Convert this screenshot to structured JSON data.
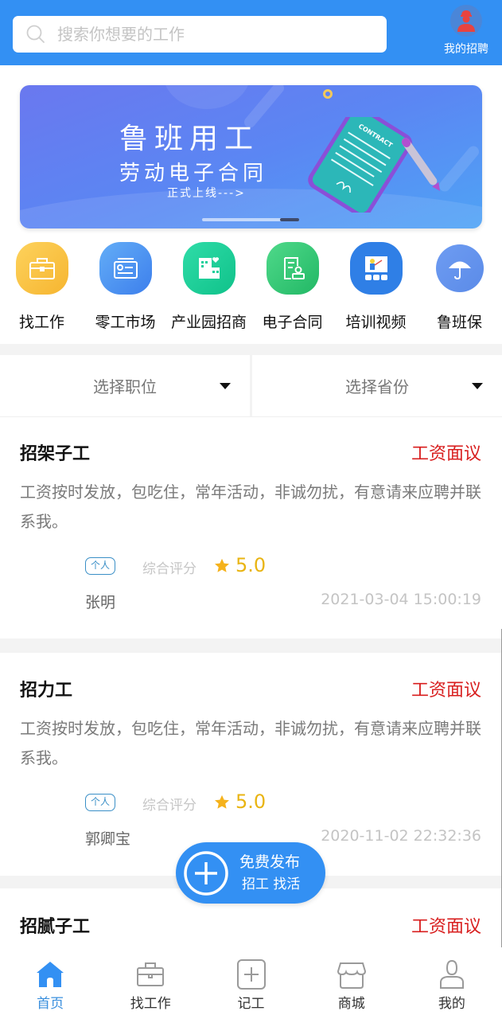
{
  "header": {
    "search_placeholder": "搜索你想要的工作",
    "my_recruit_label": "我的招聘"
  },
  "banner": {
    "title": "鲁班用工",
    "subtitle": "劳动电子合同",
    "cta": "正式上线--->",
    "contract_label": "CONTRACT",
    "slide_count": 2,
    "active_slide": 2
  },
  "quick_menu": [
    {
      "label": "找工作",
      "icon": "briefcase-icon",
      "color": "#f9c33f"
    },
    {
      "label": "零工市场",
      "icon": "id-card-icon",
      "color": "#4f93f0"
    },
    {
      "label": "产业园招商",
      "icon": "building-icon",
      "color": "#19cf9a"
    },
    {
      "label": "电子合同",
      "icon": "contract-stamp-icon",
      "color": "#2ec77a"
    },
    {
      "label": "培训视频",
      "icon": "training-icon",
      "color": "#2f7fe6"
    },
    {
      "label": "鲁班保",
      "icon": "umbrella-icon",
      "color": "#6e9cf2"
    }
  ],
  "filters": [
    {
      "label": "选择职位"
    },
    {
      "label": "选择省份"
    }
  ],
  "jobs": [
    {
      "title": "招架子工",
      "salary": "工资面议",
      "description": "工资按时发放，包吃住，常年活动，非诚勿扰，有意请来应聘并联系我。",
      "tag": "个人",
      "rating_label": "综合评分",
      "rating": "5.0",
      "poster": "张明",
      "time": "2021-03-04 15:00:19"
    },
    {
      "title": "招力工",
      "salary": "工资面议",
      "description": "工资按时发放，包吃住，常年活动，非诚勿扰，有意请来应聘并联系我。",
      "tag": "个人",
      "rating_label": "综合评分",
      "rating": "5.0",
      "poster": "郭卿宝",
      "time": "2020-11-02 22:32:36"
    },
    {
      "title": "招腻子工",
      "salary": "工资面议"
    }
  ],
  "fab": {
    "line1": "免费发布",
    "line2": "招工 找活"
  },
  "tabbar": [
    {
      "label": "首页",
      "icon": "home-icon",
      "active": true
    },
    {
      "label": "找工作",
      "icon": "briefcase-icon",
      "active": false
    },
    {
      "label": "记工",
      "icon": "plus-square-icon",
      "active": false
    },
    {
      "label": "商城",
      "icon": "shop-icon",
      "active": false
    },
    {
      "label": "我的",
      "icon": "user-icon",
      "active": false
    }
  ],
  "colors": {
    "primary": "#3390f3",
    "salary": "#d81e1e",
    "rating": "#e9b412",
    "tag": "#3a8fc7",
    "tab_active": "#3a8fdd"
  }
}
